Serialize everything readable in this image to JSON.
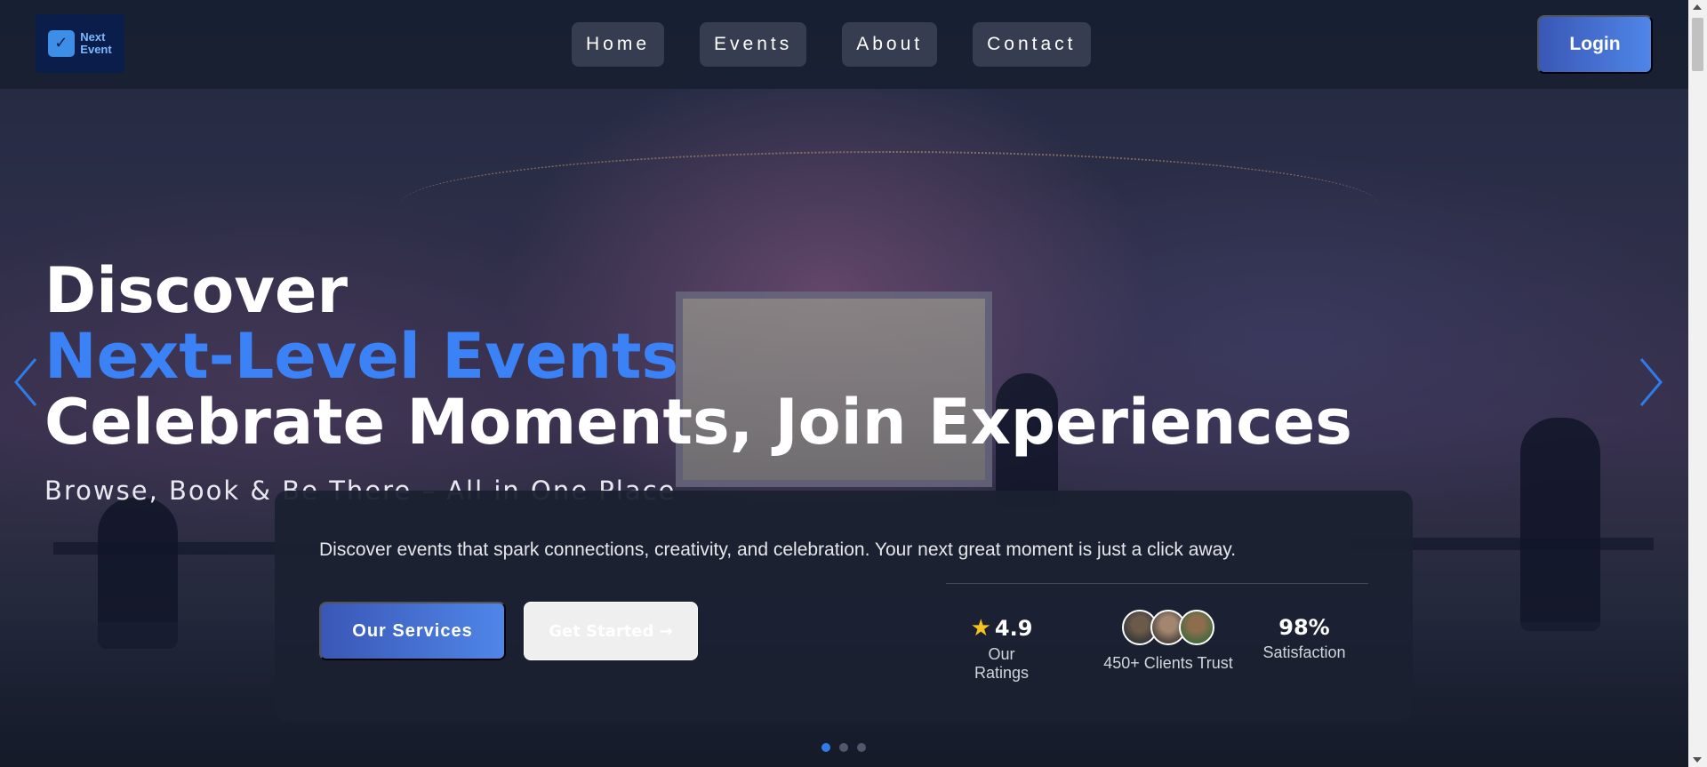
{
  "brand": {
    "logo_text_line1": "Next",
    "logo_text_line2": "Event",
    "accent": "#3b82f6"
  },
  "nav": {
    "items": [
      {
        "label": "Home"
      },
      {
        "label": "Events"
      },
      {
        "label": "About"
      },
      {
        "label": "Contact"
      }
    ],
    "login_label": "Login"
  },
  "hero": {
    "line1": "Discover",
    "line2": "Next-Level Events",
    "line3": "Celebrate Moments, Join Experiences",
    "tagline": "Browse, Book & Be There – All in One Place",
    "prev_icon": "chevron-left-icon",
    "next_icon": "chevron-right-icon"
  },
  "card": {
    "text": "Discover events that spark connections, creativity, and celebration. Your next great moment is just a click away.",
    "primary_button": "Our Services",
    "secondary_button": "Get Started →",
    "stats": {
      "rating_value": "4.9",
      "rating_label": "Our Ratings",
      "clients_label": "450+ Clients Trust",
      "satisfaction_value": "98%",
      "satisfaction_label": "Satisfaction"
    }
  },
  "carousel": {
    "slide_count": 3,
    "active_index": 0
  }
}
